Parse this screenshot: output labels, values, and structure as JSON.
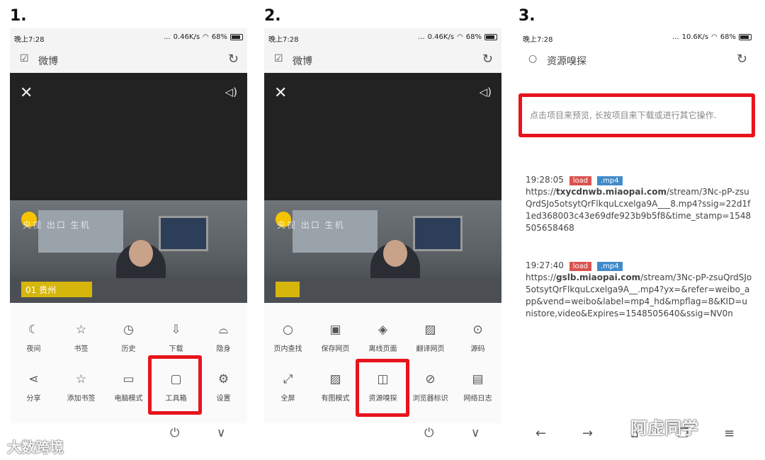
{
  "steps": [
    "1.",
    "2.",
    "3."
  ],
  "status": {
    "time": "晚上7:28",
    "dots": "...",
    "speed_1": "0.46K/s",
    "speed_2": "0.46K/s",
    "speed_3": "10.6K/s",
    "battery": "68%"
  },
  "tab_title": "微博",
  "panel3_title": "资源嗅探",
  "video_caption": "央视 出口  生机",
  "video_tag": "01 贵州",
  "menu1": {
    "row1": [
      "夜间",
      "书签",
      "历史",
      "下载",
      "隐身"
    ],
    "row2": [
      "分享",
      "添加书签",
      "电脑模式",
      "工具箱",
      "设置"
    ],
    "icons_row1": [
      "moon-icon",
      "star-icon",
      "clock-icon",
      "download-icon",
      "incognito-icon"
    ],
    "icons_row2": [
      "share-icon",
      "star-outline-icon",
      "monitor-icon",
      "toolbox-icon",
      "gear-icon"
    ]
  },
  "menu2": {
    "row1": [
      "页内查找",
      "保存网页",
      "离线页面",
      "翻译网页",
      "源码"
    ],
    "row2": [
      "全屏",
      "有图模式",
      "资源嗅探",
      "浏览器标识",
      "网络日志"
    ],
    "icons_row1": [
      "search-icon",
      "save-icon",
      "layers-icon",
      "translate-icon",
      "code-icon"
    ],
    "icons_row2": [
      "fullscreen-icon",
      "image-icon",
      "sniff-icon",
      "browser-id-icon",
      "log-icon"
    ]
  },
  "sniffer": {
    "hint": "点击项目来预览, 长按项目来下载或进行其它操作.",
    "resources": [
      {
        "time": "19:28:05",
        "tag": "load",
        "ext": ".mp4",
        "url_prefix": "https://",
        "host": "txycdnwb.miaopai.com",
        "rest": "/stream/3Nc-pP-zsuQrdSJo5otsytQrFlkquLcxelga9A___8.mp4?ssig=22d1f1ed368003c43e69dfe923b9b5f8&time_stamp=1548505658468"
      },
      {
        "time": "19:27:40",
        "tag": "load",
        "ext": ".mp4",
        "url_prefix": "https://",
        "host": "gslb.miaopai.com",
        "rest": "/stream/3Nc-pP-zsuQrdSJo5otsytQrFlkquLcxelga9A__.mp4?yx=&refer=weibo_app&vend=weibo&label=mp4_hd&mpflag=8&KID=unistore,video&Expires=1548505640&ssig=NV0n"
      }
    ]
  },
  "watermarks": {
    "left": "大数跨境",
    "right": "阿虚同学"
  },
  "highlight_color": "#e8141c"
}
